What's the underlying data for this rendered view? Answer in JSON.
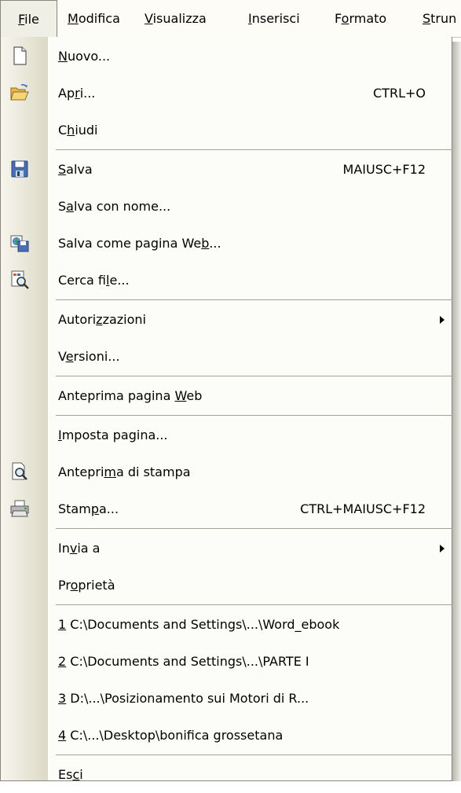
{
  "menubar": [
    {
      "pre": "",
      "key": "F",
      "post": "ile"
    },
    {
      "pre": "",
      "key": "M",
      "post": "odifica"
    },
    {
      "pre": "",
      "key": "V",
      "post": "isualizza"
    },
    {
      "pre": "",
      "key": "I",
      "post": "nserisci"
    },
    {
      "pre": "F",
      "key": "o",
      "post": "rmato"
    },
    {
      "pre": "",
      "key": "S",
      "post": "trun"
    }
  ],
  "items": [
    {
      "pre": "",
      "key": "N",
      "post": "uovo...",
      "shortcut": "",
      "icon": "new-document-icon"
    },
    {
      "pre": "Ap",
      "key": "r",
      "post": "i...",
      "shortcut": "CTRL+O",
      "icon": "open-folder-icon"
    },
    {
      "pre": "C",
      "key": "h",
      "post": "iudi",
      "shortcut": "",
      "icon": ""
    },
    {
      "pre": "",
      "key": "S",
      "post": "alva",
      "shortcut": "MAIUSC+F12",
      "icon": "save-disk-icon"
    },
    {
      "pre": "S",
      "key": "a",
      "post": "lva con nome...",
      "shortcut": "",
      "icon": ""
    },
    {
      "pre": "Salva come pagina We",
      "key": "b",
      "post": "...",
      "shortcut": "",
      "icon": "save-web-page-icon"
    },
    {
      "pre": "Cerca fi",
      "key": "l",
      "post": "e...",
      "shortcut": "",
      "icon": "file-search-icon"
    },
    {
      "pre": "Autori",
      "key": "z",
      "post": "zazioni",
      "shortcut": "",
      "icon": ""
    },
    {
      "pre": "V",
      "key": "e",
      "post": "rsioni...",
      "shortcut": "",
      "icon": ""
    },
    {
      "pre": "Anteprima pagina ",
      "key": "W",
      "post": "eb",
      "shortcut": "",
      "icon": ""
    },
    {
      "pre": "",
      "key": "I",
      "post": "mposta pagina...",
      "shortcut": "",
      "icon": ""
    },
    {
      "pre": "Antepri",
      "key": "m",
      "post": "a di stampa",
      "shortcut": "",
      "icon": "print-preview-icon"
    },
    {
      "pre": "Stam",
      "key": "p",
      "post": "a...",
      "shortcut": "CTRL+MAIUSC+F12",
      "icon": "printer-icon"
    },
    {
      "pre": "In",
      "key": "v",
      "post": "ia a",
      "shortcut": "",
      "icon": ""
    },
    {
      "pre": "Pr",
      "key": "o",
      "post": "prietà",
      "shortcut": "",
      "icon": ""
    },
    {
      "pre": "",
      "key": "1",
      "post": " C:\\Documents and Settings\\...\\Word_ebook",
      "shortcut": "",
      "icon": ""
    },
    {
      "pre": "",
      "key": "2",
      "post": " C:\\Documents and Settings\\...\\PARTE  I",
      "shortcut": "",
      "icon": ""
    },
    {
      "pre": "",
      "key": "3",
      "post": " D:\\...\\Posizionamento sui Motori di R...",
      "shortcut": "",
      "icon": ""
    },
    {
      "pre": "",
      "key": "4",
      "post": " C:\\...\\Desktop\\bonifica grossetana",
      "shortcut": "",
      "icon": ""
    },
    {
      "pre": "Es",
      "key": "c",
      "post": "i",
      "shortcut": "",
      "icon": ""
    }
  ],
  "colors": {
    "menubar_bg": "#fdfcf6",
    "dropdown_bg": "#fcfcf9",
    "icon_strip_light": "#f7f6ee",
    "icon_strip_dark": "#dcd9c6",
    "separator": "#a5a294",
    "border": "#8a867a"
  }
}
